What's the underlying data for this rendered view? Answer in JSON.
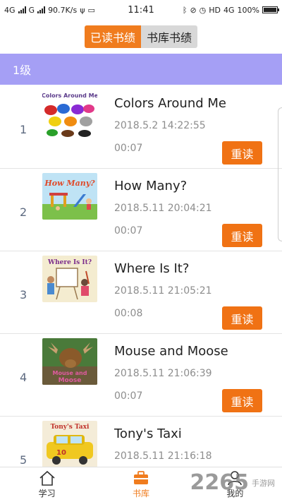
{
  "status_bar": {
    "left_text": "4G",
    "left_text2": "G",
    "speed": "90.7K/s",
    "time": "11:41",
    "right_hd": "HD",
    "right_4g": "4G",
    "battery": "100%",
    "battery_level": 1.0
  },
  "header": {
    "tab_active": "已读书绩",
    "tab_inactive": "书库书绩"
  },
  "level": {
    "label": "1级"
  },
  "books": [
    {
      "index": "1",
      "title": "Colors Around Me",
      "date": "2018.5.2 14:22:55",
      "duration": "00:07",
      "button": "重读",
      "cover_icon": "colors-around-me-cover"
    },
    {
      "index": "2",
      "title": "How Many?",
      "date": "2018.5.11 20:04:21",
      "duration": "00:07",
      "button": "重读",
      "cover_icon": "how-many-cover"
    },
    {
      "index": "3",
      "title": "Where Is It?",
      "date": "2018.5.11 21:05:21",
      "duration": "00:08",
      "button": "重读",
      "cover_icon": "where-is-it-cover"
    },
    {
      "index": "4",
      "title": "Mouse and Moose",
      "date": "2018.5.11 21:06:39",
      "duration": "00:07",
      "button": "重读",
      "cover_icon": "mouse-and-moose-cover"
    },
    {
      "index": "5",
      "title": "Tony's Taxi",
      "date": "2018.5.11 21:16:18",
      "duration": "",
      "button": "",
      "cover_icon": "tonys-taxi-cover"
    }
  ],
  "bottom_nav": {
    "learn": "学习",
    "library": "书库",
    "mine": "我的"
  },
  "watermark": {
    "big": "2265",
    "small": "手游网"
  },
  "colors": {
    "accent": "#f07c1e",
    "level_bar": "#a59ff5"
  }
}
